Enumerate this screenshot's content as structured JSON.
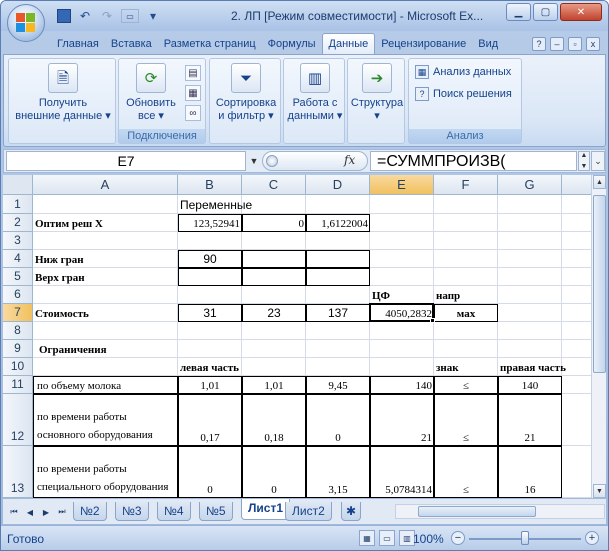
{
  "window": {
    "title": "2. ЛП  [Режим совместимости] - Microsoft Ex...",
    "controls": [
      "minimize",
      "maximize",
      "close"
    ]
  },
  "quick_access": {
    "items": [
      "save-icon",
      "undo-icon",
      "redo-icon",
      "customize-icon"
    ],
    "undo_glyph": "↶",
    "redo_glyph": "↷",
    "dropdown_glyph": "▾"
  },
  "ribbon_tabs": [
    "Главная",
    "Вставка",
    "Разметка страниц",
    "Формулы",
    "Данные",
    "Рецензирование",
    "Вид"
  ],
  "active_tab": "Данные",
  "ribbon": {
    "get_external": "Получить\nвнешние данные ▾",
    "refresh": "Обновить\nвсе ▾",
    "connections_label": "Подключения",
    "sort_filter": "Сортировка\nи фильтр ▾",
    "data_tools": "Работа с\nданными ▾",
    "outline": "Структура\n▾",
    "analysis_data": "Анализ данных",
    "solver": "Поиск решения",
    "analysis_label": "Анализ"
  },
  "formula_bar": {
    "name_box": "E7",
    "fx": "fx",
    "formula": "=СУММПРОИЗВ("
  },
  "columns": [
    "A",
    "B",
    "C",
    "D",
    "E",
    "F",
    "G"
  ],
  "rows": [
    "1",
    "2",
    "3",
    "4",
    "5",
    "6",
    "7",
    "8",
    "9",
    "10",
    "11",
    "12",
    "13"
  ],
  "active_cell": {
    "col": "E",
    "row": "7"
  },
  "cells": {
    "B1": "Переменные",
    "A2": "Оптим реш X",
    "B2": "123,52941",
    "C2": "0",
    "D2": "1,6122004",
    "A4": "Ниж гран",
    "B4": "90",
    "A5": "Верх гран",
    "E6": "ЦФ",
    "F6": "напр",
    "A7": "Стоимость",
    "B7": "31",
    "C7": "23",
    "D7": "137",
    "E7": "4050,2832",
    "F7": "мах",
    "A9": "Ограничения",
    "B10": "левая часть",
    "F10": "знак",
    "G10": "правая часть",
    "A11": "по объему молока",
    "B11": "1,01",
    "C11": "1,01",
    "D11": "9,45",
    "E11": "140",
    "F11": "≤",
    "G11": "140",
    "A12": "по времени работы основного оборудования",
    "B12": "0,17",
    "C12": "0,18",
    "D12": "0",
    "E12": "21",
    "F12": "≤",
    "G12": "21",
    "A13": "по времени работы специального оборудования",
    "B13": "0",
    "C13": "0",
    "D13": "3,15",
    "E13": "5,0784314",
    "F13": "≤",
    "G13": "16"
  },
  "sheet_tabs": [
    "№2",
    "№3",
    "№4",
    "№5",
    "Лист1",
    "Лист2"
  ],
  "active_sheet": "Лист1",
  "status": {
    "ready": "Готово",
    "zoom": "100%",
    "zoom_fraction": 0.5
  }
}
